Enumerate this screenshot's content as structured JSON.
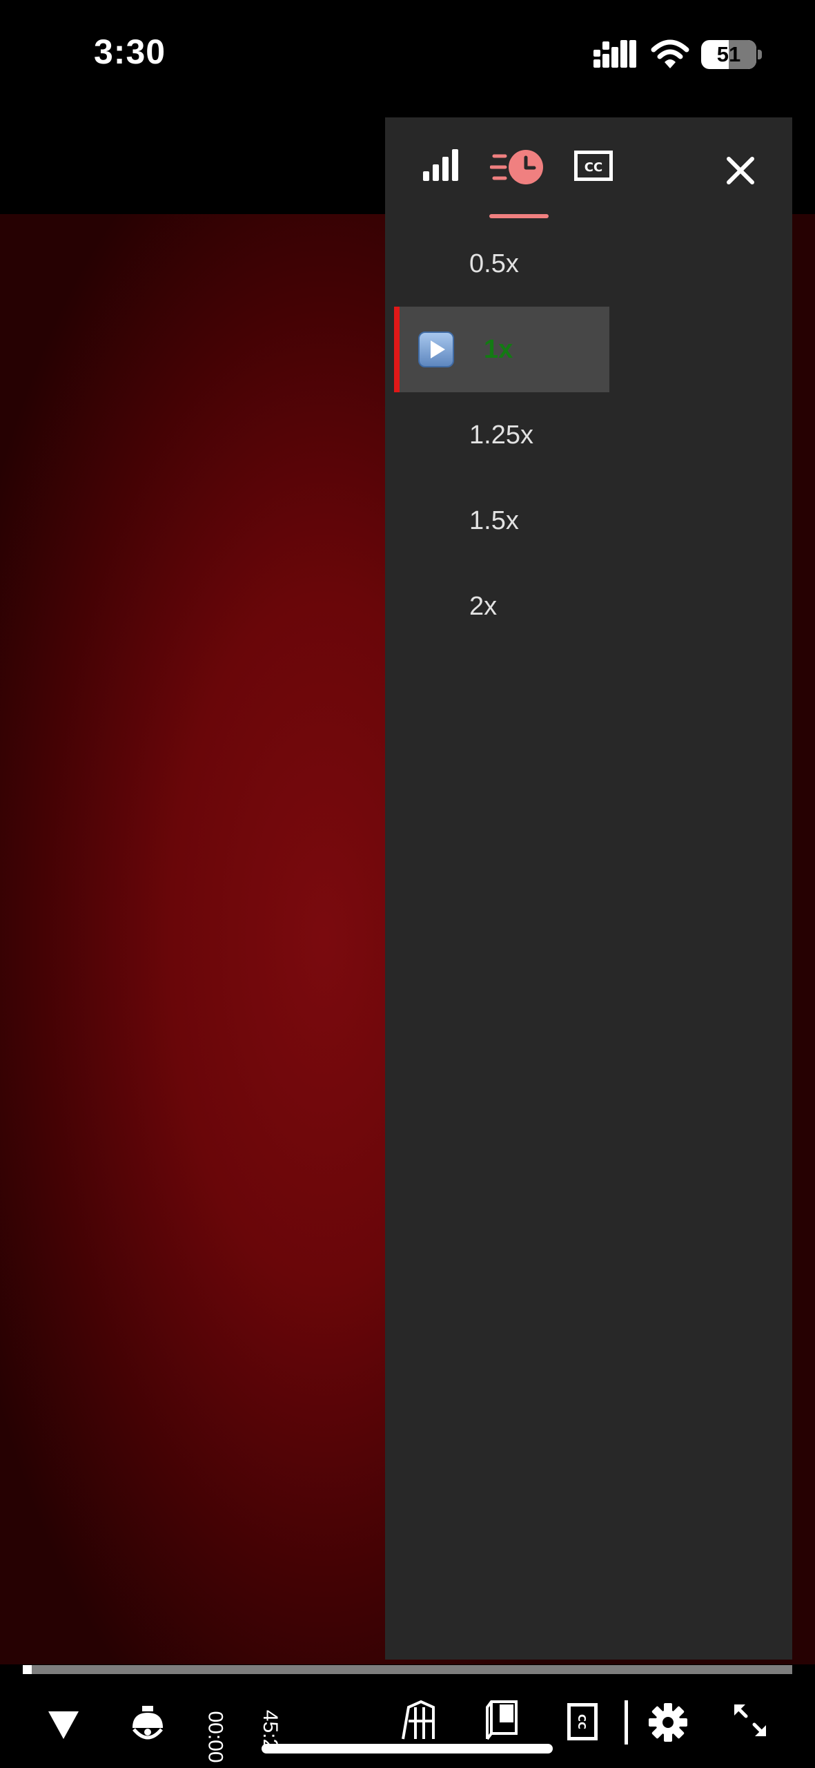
{
  "status_bar": {
    "time": "3:30",
    "battery_level": "51",
    "icons": [
      "cellular-signal-icon",
      "wifi-icon",
      "battery-icon"
    ]
  },
  "settings_panel": {
    "tabs": [
      {
        "id": "quality",
        "icon": "signal-bars-icon",
        "active": false
      },
      {
        "id": "speed",
        "icon": "playback-speed-icon",
        "active": true
      },
      {
        "id": "captions",
        "icon": "cc-icon",
        "active": false
      }
    ],
    "close_icon": "close-icon",
    "speed_options": [
      {
        "label": "0.5x",
        "selected": false
      },
      {
        "label": "1x",
        "selected": true
      },
      {
        "label": "1.25x",
        "selected": false
      },
      {
        "label": "1.5x",
        "selected": false
      },
      {
        "label": "2x",
        "selected": false
      }
    ],
    "accent_color": "#f08080",
    "selected_color": "#137a13",
    "selected_bar_color": "#e01818"
  },
  "player": {
    "progress_fraction": 0.012,
    "current_time": "00:00",
    "duration": "45:2",
    "controls": [
      "collapse-icon",
      "lamp-icon",
      "building-icon",
      "book-icon",
      "cc-icon",
      "settings-icon",
      "fullscreen-icon"
    ]
  }
}
